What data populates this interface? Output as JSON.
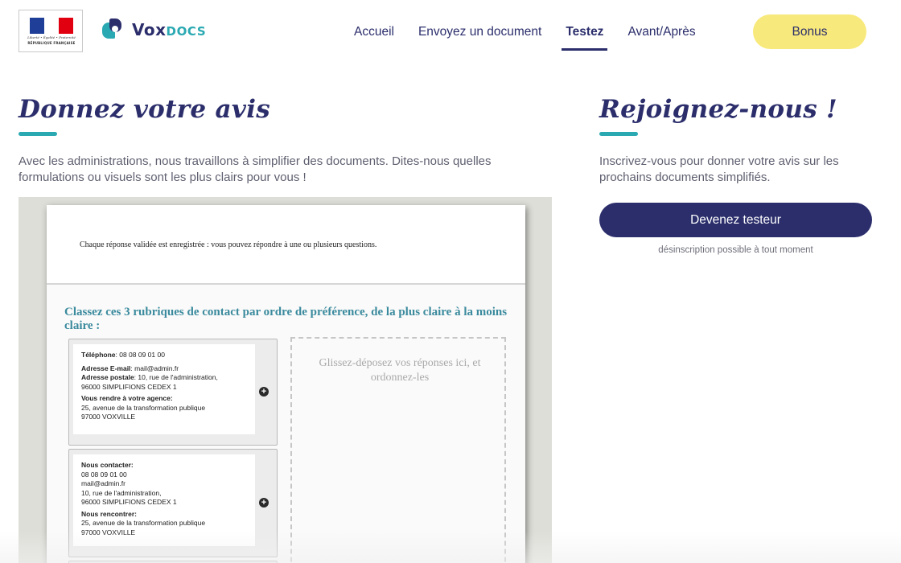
{
  "header": {
    "gov_logo": {
      "motto": "Liberté • Égalité • Fraternité",
      "name": "RÉPUBLIQUE FRANÇAISE",
      "flag_colors": [
        "#1f3e97",
        "#ffffff",
        "#e1000f"
      ]
    },
    "brand": {
      "part1": "Vox",
      "part2": "DOCS"
    },
    "nav": [
      {
        "label": "Accueil",
        "active": false
      },
      {
        "label": "Envoyez un document",
        "active": false
      },
      {
        "label": "Testez",
        "active": true
      },
      {
        "label": "Avant/Après",
        "active": false
      }
    ],
    "bonus_label": "Bonus"
  },
  "left": {
    "title": "Donnez votre avis",
    "intro": "Avec les administrations, nous travaillons à simplifier des documents. Dites-nous quelles formulations ou visuels sont les plus clairs pour vous !",
    "preview": {
      "note": "Chaque réponse validée est enregistrée : vous pouvez répondre à une ou plusieurs questions.",
      "question": "Classez ces 3 rubriques de contact par ordre de préférence, de la plus claire à la moins claire :",
      "card1": {
        "phone_label": "Téléphone",
        "phone_value": ": 08 08 09 01 00",
        "email_label": "Adresse E-mail",
        "email_value": ": mail@admin.fr",
        "postal_label": "Adresse postale",
        "postal_value": ": 10, rue de l'administration,",
        "postal_city": "96000 SIMPLIFIONS CEDEX 1",
        "agency_label": "Vous rendre à votre agence:",
        "agency_line1": "25, avenue de la transformation publique",
        "agency_line2": "97000 VOXVILLE"
      },
      "card2": {
        "contact_label": "Nous contacter:",
        "line1": "08 08 09 01 00",
        "line2": "mail@admin.fr",
        "line3": "10, rue de l'administration,",
        "line4": "96000 SIMPLIFIONS CEDEX 1",
        "meet_label": "Nous rencontrer:",
        "line5": "25, avenue de la transformation publique",
        "line6": "97000 VOXVILLE"
      },
      "drop_text": "Glissez-déposez vos réponses ici, et ordonnez-les",
      "plus_icon": "plus-circle-icon"
    }
  },
  "right": {
    "title": "Rejoignez-nous !",
    "intro": "Inscrivez-vous pour donner votre avis sur les prochains documents simplifiés.",
    "cta_label": "Devenez testeur",
    "note": "désinscription possible à tout moment"
  },
  "colors": {
    "navy": "#2b2e6b",
    "teal": "#2aa9b2",
    "yellow": "#f8e97c",
    "body_text": "#5f6070"
  }
}
